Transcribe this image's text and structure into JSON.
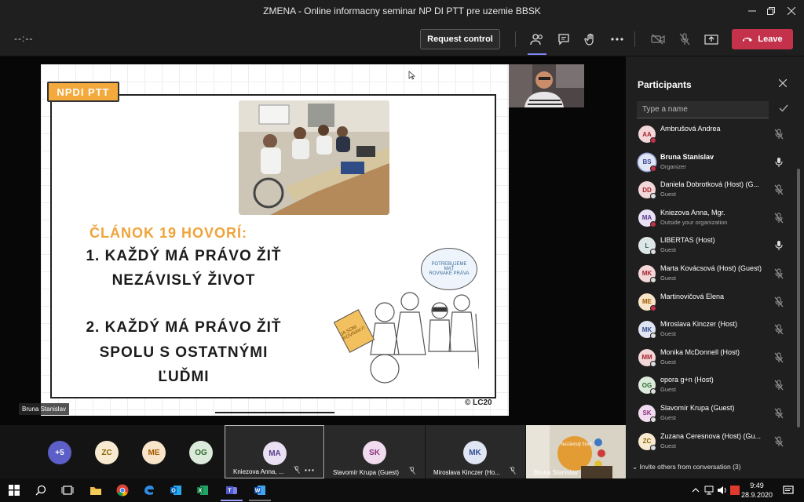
{
  "window": {
    "title": "ZMENA - Online informacny seminar NP DI PTT pre uzemie BBSK"
  },
  "toolbar": {
    "timer": "--:--",
    "request_control": "Request control",
    "leave": "Leave"
  },
  "slide": {
    "badge": "NPDI PTT",
    "heading": "ČLÁNOK 19 HOVORÍ:",
    "line1": "1. KAŽDÝ MÁ PRÁVO ŽIŤ",
    "line2": "NEZÁVISLÝ ŽIVOT",
    "line3": "2. KAŽDÝ MÁ PRÁVO ŽIŤ",
    "line4": "SPOLU S OSTATNÝMI",
    "line5": "ĽUĎMI",
    "bubble_1": "POTREBUJEME",
    "bubble_2": "MAŤ",
    "bubble_3": "ROVNAKÉ PRÁVA",
    "sign": "JA SOM ROVNAKÝ!",
    "copyright": "© LC20"
  },
  "stage": {
    "presenter_label": "Bruna Stanislav"
  },
  "participants": {
    "title": "Participants",
    "search_placeholder": "Type a name",
    "list": [
      {
        "initials": "AA",
        "name": "Ambrušová Andrea",
        "role": "",
        "avatar_bg": "#f3d6d8",
        "avatar_fg": "#a4262c",
        "badge": "#c4314b",
        "mic": "muted"
      },
      {
        "initials": "BS",
        "name": "Bruna Stanislav",
        "role": "Organizer",
        "avatar_bg": "#e1e6f5",
        "avatar_fg": "#3b4a9b",
        "badge": "#c4314b",
        "mic": "on"
      },
      {
        "initials": "DD",
        "name": "Daniela Dobrotková (Host) (G...",
        "role": "Guest",
        "avatar_bg": "#f3d6d8",
        "avatar_fg": "#a4262c",
        "badge": "#ddd",
        "mic": "muted"
      },
      {
        "initials": "MA",
        "name": "Kniezova Anna, Mgr.",
        "role": "Outside your organization",
        "avatar_bg": "#e9e1f3",
        "avatar_fg": "#5c3b8f",
        "badge": "#c4314b",
        "mic": "muted"
      },
      {
        "initials": "L",
        "name": "LIBERTAS (Host)",
        "role": "Guest",
        "avatar_bg": "#dde6e6",
        "avatar_fg": "#335f5f",
        "badge": "#ddd",
        "mic": "on"
      },
      {
        "initials": "MK",
        "name": "Marta Kovácsová (Host) (Guest)",
        "role": "Guest",
        "avatar_bg": "#f3d6d8",
        "avatar_fg": "#a4262c",
        "badge": "#ddd",
        "mic": "muted"
      },
      {
        "initials": "ME",
        "name": "Martinovičová Elena",
        "role": "",
        "avatar_bg": "#f8e4c9",
        "avatar_fg": "#a35b00",
        "badge": "#c4314b",
        "mic": "muted"
      },
      {
        "initials": "MK",
        "name": "Miroslava Kinczer (Host)",
        "role": "Guest",
        "avatar_bg": "#dfe5f3",
        "avatar_fg": "#33508f",
        "badge": "#ddd",
        "mic": "muted"
      },
      {
        "initials": "MM",
        "name": "Monika McDonnell (Host)",
        "role": "Guest",
        "avatar_bg": "#f3d6d8",
        "avatar_fg": "#a4262c",
        "badge": "#ddd",
        "mic": "muted"
      },
      {
        "initials": "OG",
        "name": "opora g+n (Host)",
        "role": "Guest",
        "avatar_bg": "#dbeadb",
        "avatar_fg": "#2e6b2e",
        "badge": "#ddd",
        "mic": "muted"
      },
      {
        "initials": "SK",
        "name": "Slavomír Krupa (Guest)",
        "role": "Guest",
        "avatar_bg": "#f1dcef",
        "avatar_fg": "#8a2f7f",
        "badge": "#ddd",
        "mic": "muted"
      },
      {
        "initials": "ZC",
        "name": "Zuzana Ceresnova (Host) (Gu...",
        "role": "Guest",
        "avatar_bg": "#f8ead0",
        "avatar_fg": "#8a6400",
        "badge": "#ddd",
        "mic": "muted"
      }
    ],
    "invite_label": "Invite others from conversation (3)"
  },
  "strip": {
    "more_count": "+5",
    "avatars": [
      {
        "initials": "ZC",
        "bg": "#f8ead0",
        "fg": "#8a6400"
      },
      {
        "initials": "ME",
        "bg": "#f8e4c9",
        "fg": "#a35b00"
      },
      {
        "initials": "OG",
        "bg": "#dbeadb",
        "fg": "#2e6b2e"
      }
    ],
    "tiles": [
      {
        "initials": "MA",
        "name": "Kniezova Anna, ...",
        "bg": "#e9e1f3",
        "fg": "#5c3b8f"
      },
      {
        "initials": "SK",
        "name": "Slavomír Krupa (Guest)",
        "bg": "#f1dcef",
        "fg": "#8a2f7f"
      },
      {
        "initials": "MK",
        "name": "Miroslava Kinczer (Ho...",
        "bg": "#dfe5f3",
        "fg": "#33508f"
      }
    ],
    "video_tile_name": "Bruna Stanislav",
    "video_tile_text": "Nezávislý život"
  },
  "taskbar": {
    "time": "9:49",
    "date": "28.9.2020"
  }
}
